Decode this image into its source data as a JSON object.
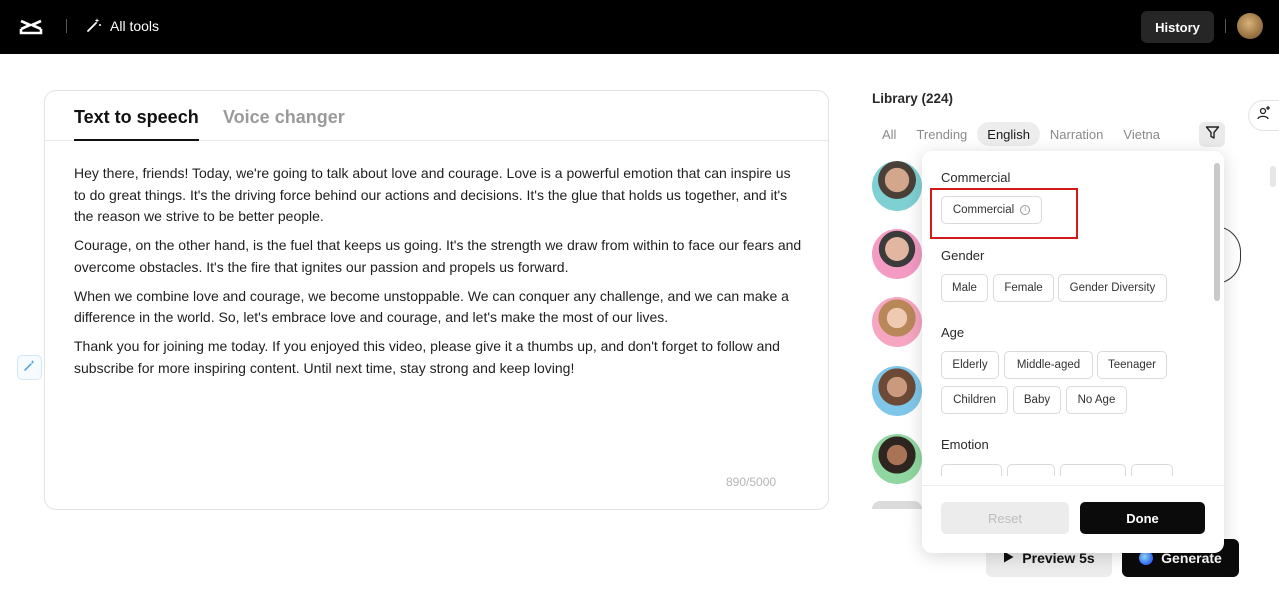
{
  "topbar": {
    "logo_icon": "capcut-logo-icon",
    "all_tools_label": "All tools",
    "history_label": "History"
  },
  "editor": {
    "tabs": [
      {
        "label": "Text to speech",
        "active": true
      },
      {
        "label": "Voice changer",
        "active": false
      }
    ],
    "paragraphs": [
      "Hey there, friends! Today, we're going to talk about love and courage. Love is a powerful emotion that can inspire us to do great things. It's the driving force behind our actions and decisions. It's the glue that holds us together, and it's the reason we strive to be better people.",
      "Courage, on the other hand, is the fuel that keeps us going. It's the strength we draw from within to face our fears and overcome obstacles. It's the fire that ignites our passion and propels us forward.",
      "When we combine love and courage, we become unstoppable. We can conquer any challenge, and we can make a difference in the world. So, let's embrace love and courage, and let's make the most of our lives.",
      "Thank you for joining me today. If you enjoyed this video, please give it a thumbs up, and don't forget to follow and subscribe for more inspiring content. Until next time, stay strong and keep loving!"
    ],
    "char_count": "890/5000"
  },
  "library": {
    "title": "Library (224)",
    "tabs": [
      "All",
      "Trending",
      "English",
      "Narration",
      "Vietna"
    ],
    "selected_tab": "English"
  },
  "filter_popover": {
    "sections": {
      "commercial": {
        "title": "Commercial",
        "chips": [
          "Commercial"
        ]
      },
      "gender": {
        "title": "Gender",
        "chips": [
          "Male",
          "Female",
          "Gender Diversity"
        ]
      },
      "age": {
        "title": "Age",
        "chips": [
          "Elderly",
          "Middle-aged",
          "Teenager",
          "Children",
          "Baby",
          "No Age"
        ]
      },
      "emotion": {
        "title": "Emotion"
      }
    },
    "reset_label": "Reset",
    "done_label": "Done"
  },
  "actions": {
    "preview_label": "Preview 5s",
    "generate_label": "Generate"
  },
  "colors": {
    "highlight": "#d21a1a",
    "topbar": "#000000",
    "primary_button": "#0b0b0b"
  }
}
